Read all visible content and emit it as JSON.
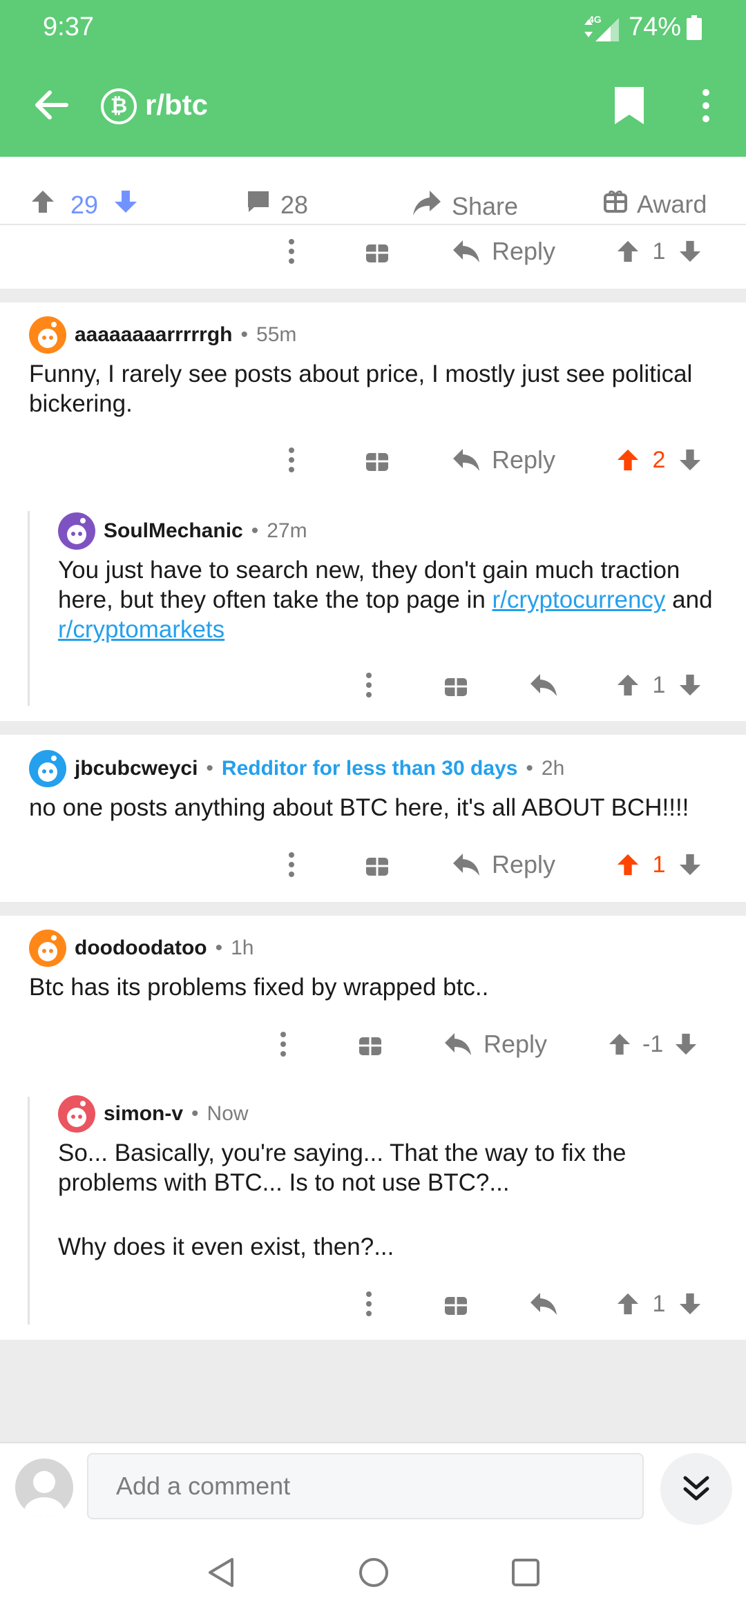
{
  "status": {
    "time": "9:37",
    "network": "4G",
    "battery": "74%"
  },
  "app_bar": {
    "subreddit": "r/btc",
    "subreddit_icon": "bitcoin-icon"
  },
  "post_bar": {
    "score": "29",
    "comments": "28",
    "share": "Share",
    "award": "Award"
  },
  "actions": {
    "reply": "Reply"
  },
  "top_action_row": {
    "score": "1"
  },
  "comments": [
    {
      "username": "aaaaaaaarrrrrgh",
      "time": "55m",
      "body": "Funny, I rarely see posts about price, I mostly just see political bickering.",
      "score": "2"
    },
    {
      "username": "SoulMechanic",
      "time": "27m",
      "body_text": "You just have to search new, they don't gain much traction here, but they often take the top page in ",
      "link1": "r/cryptocurrency",
      "mid": " and ",
      "link2": "r/cryptomarkets",
      "score": "1"
    },
    {
      "username": "jbcubcweyci",
      "flair": "Redditor for less than 30 days",
      "time": "2h",
      "body": "no one posts anything about BTC here, it's all ABOUT BCH!!!!",
      "score": "1"
    },
    {
      "username": "doodoodatoo",
      "time": "1h",
      "body": "Btc has its problems fixed by wrapped btc..",
      "score": "-1"
    },
    {
      "username": "simon-v",
      "time": "Now",
      "body_line1": "So... Basically, you're saying... That the way to fix the problems with BTC... Is to not use BTC?...",
      "body_line2": "Why does it even exist, then?...",
      "score": "1"
    }
  ],
  "comment_input": {
    "placeholder": "Add a comment"
  },
  "colors": {
    "accent": "#5ecb76",
    "upvote": "#ff4500",
    "link": "#24a0ed",
    "vote_blue": "#7193ff"
  }
}
